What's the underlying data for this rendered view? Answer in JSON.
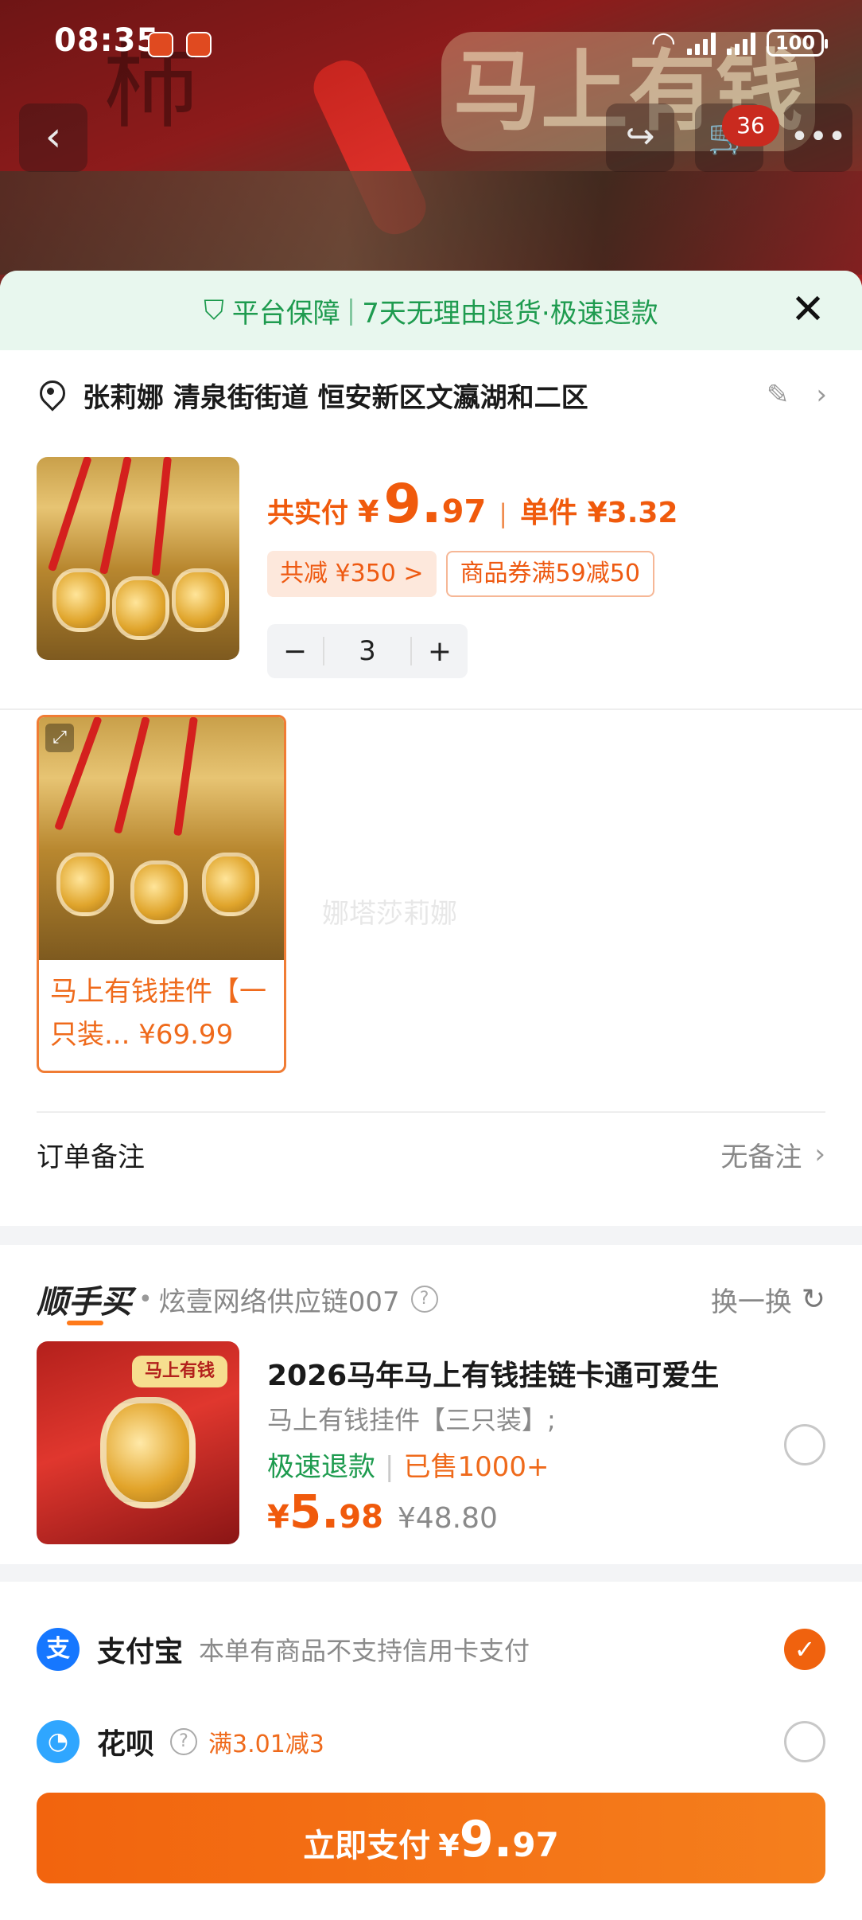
{
  "status_bar": {
    "time": "08:35",
    "battery": "100"
  },
  "header": {
    "cart_count": "36",
    "background_plaque_text": "马上有钱"
  },
  "guarantee_banner": {
    "title": "平台保障",
    "separator": "|",
    "text": "7天无理由退货·极速退款"
  },
  "address": {
    "text": "张莉娜 清泉街街道 恒安新区文瀛湖和二区"
  },
  "summary": {
    "pay_label": "共实付",
    "currency": "¥",
    "total_int": "9.",
    "total_dec": "97",
    "separator": "|",
    "unit_price": "单件 ¥3.32",
    "discount_tag": "共减 ¥350 >",
    "coupon_tag": "商品券满59减50",
    "quantity": "3",
    "minus": "−",
    "plus": "+"
  },
  "variant": {
    "label": "马上有钱挂件【一只装... ¥69.99",
    "selected": true
  },
  "watermark": "娜塔莎莉娜",
  "order_note": {
    "label": "订单备注",
    "value": "无备注"
  },
  "recommendation": {
    "logo": "顺手买",
    "store": "炫壹网络供应链007",
    "swap_label": "换一换",
    "item": {
      "title": "2026马年马上有钱挂链卡通可爱生",
      "variant": "马上有钱挂件【三只装】;",
      "badge_refund": "极速退款",
      "badge_sold": "已售1000+",
      "currency": "¥",
      "price_int": "5.",
      "price_dec": "98",
      "original_price": "¥48.80",
      "plaque_text": "马上有钱",
      "selected": false
    }
  },
  "payment_methods": [
    {
      "icon": "alipay-icon",
      "name": "支付宝",
      "note": "本单有商品不支持信用卡支付",
      "selected": true
    },
    {
      "icon": "huabei-icon",
      "name": "花呗",
      "promo": "满3.01减3",
      "selected": false
    }
  ],
  "pay_button": {
    "label": "立即支付",
    "currency": "¥",
    "amount_int": "9.",
    "amount_dec": "97"
  },
  "colors": {
    "accent": "#f0620e",
    "guarantee_green": "#1e9b4f",
    "guarantee_bg": "#e8f7ee",
    "alipay_blue": "#1677ff"
  }
}
